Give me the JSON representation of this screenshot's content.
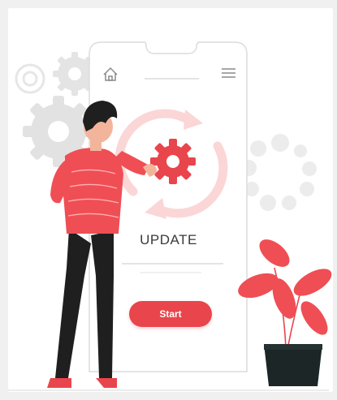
{
  "screen": {
    "update_label": "UPDATE",
    "start_label": "Start"
  },
  "colors": {
    "accent": "#e9454c",
    "shirt": "#ef4e55",
    "gear_gray": "#e2e2e2",
    "dark": "#1f1f1f",
    "pot": "#1c2626"
  },
  "icons": [
    "home-icon",
    "menu-icon",
    "gear-icon",
    "plant-icon"
  ]
}
